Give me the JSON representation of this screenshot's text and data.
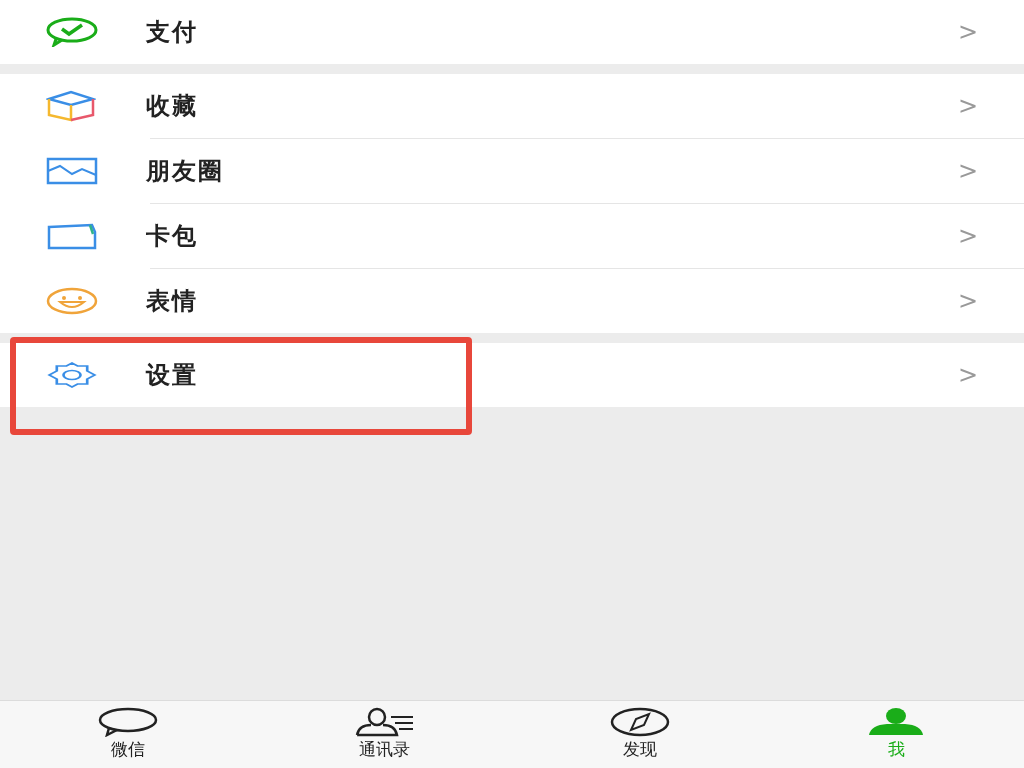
{
  "groups": [
    {
      "items": [
        {
          "kind": "pay",
          "label": "支付",
          "chevron": ">",
          "highlighted": false
        }
      ]
    },
    {
      "items": [
        {
          "kind": "favorites",
          "label": "收藏",
          "chevron": ">",
          "highlighted": false
        },
        {
          "kind": "moments",
          "label": "朋友圈",
          "chevron": ">",
          "highlighted": false
        },
        {
          "kind": "cards",
          "label": "卡包",
          "chevron": ">",
          "highlighted": false
        },
        {
          "kind": "stickers",
          "label": "表情",
          "chevron": ">",
          "highlighted": false
        }
      ]
    },
    {
      "items": [
        {
          "kind": "settings",
          "label": "设置",
          "chevron": ">",
          "highlighted": true
        }
      ]
    }
  ],
  "tabs": [
    {
      "kind": "chats",
      "label": "微信",
      "selected": false
    },
    {
      "kind": "contacts",
      "label": "通讯录",
      "selected": false
    },
    {
      "kind": "discover",
      "label": "发现",
      "selected": false
    },
    {
      "kind": "me",
      "label": "我",
      "selected": true
    }
  ]
}
